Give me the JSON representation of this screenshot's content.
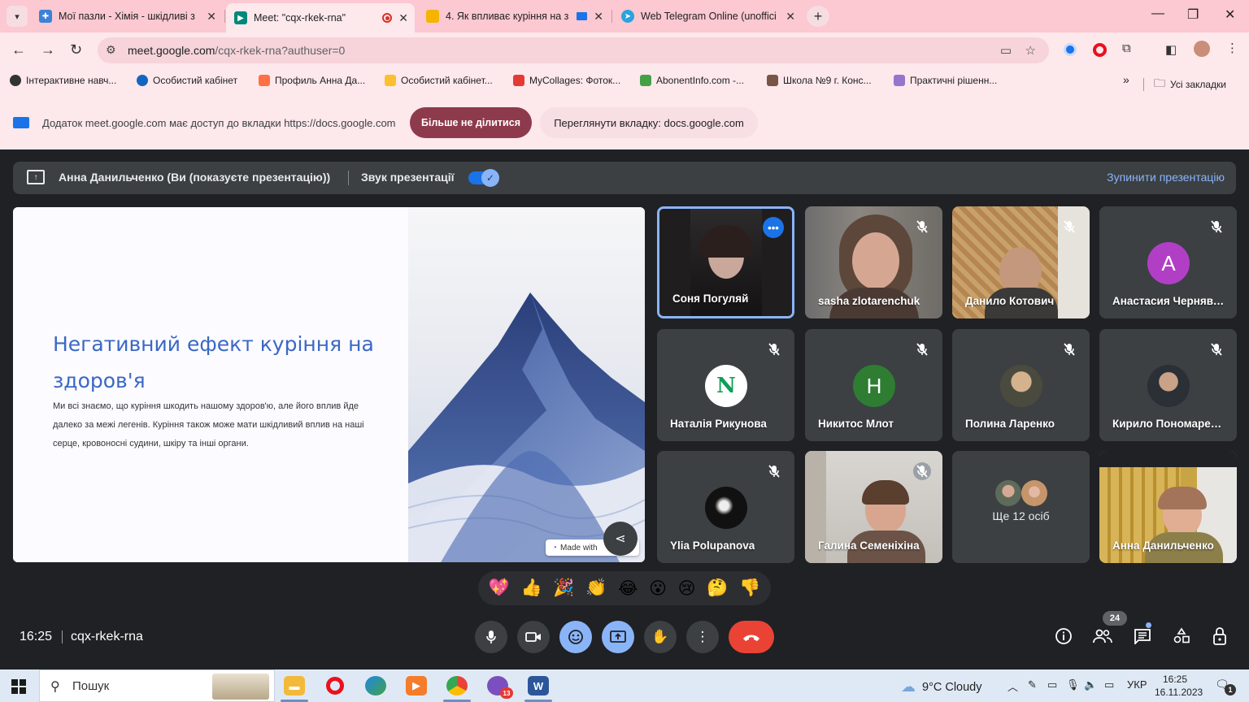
{
  "browser": {
    "tabs": [
      {
        "title": "Мої пазли - Хімія - шкідливі з",
        "favicon_color": "#3b82d8",
        "active": false,
        "recording": false
      },
      {
        "title": "Meet: \"cqx-rkek-rna\"",
        "favicon_color": "#00897b",
        "active": true,
        "recording": true
      },
      {
        "title": "4. Як впливає куріння на з",
        "favicon_color": "#f4b400",
        "active": false,
        "recording": false
      },
      {
        "title": "Web Telegram Online (unoffici",
        "favicon_color": "#2aa3df",
        "active": false,
        "recording": false
      }
    ],
    "url_host": "meet.google.com",
    "url_path": "/cqx-rkek-rna?authuser=0",
    "bookmarks": [
      {
        "label": "Інтерактивне навч...",
        "color": "#333333"
      },
      {
        "label": "Особистий кабінет",
        "color": "#1565c0"
      },
      {
        "label": "Профиль Анна Да...",
        "color": "#ff7043"
      },
      {
        "label": "Особистий кабінет...",
        "color": "#fbc02d"
      },
      {
        "label": "MyCollages: Фоток...",
        "color": "#e53935"
      },
      {
        "label": "AbonentInfo.com -...",
        "color": "#43a047"
      },
      {
        "label": "Школа №9 г. Конс...",
        "color": "#795548"
      },
      {
        "label": "Практичні рішенн...",
        "color": "#9575cd"
      }
    ],
    "bookmarks_overflow": "»",
    "all_bookmarks": "Усі закладки",
    "share_notice": "Додаток meet.google.com має доступ до вкладки https://docs.google.com",
    "stop_sharing_label": "Більше не ділитися",
    "view_tab_label": "Переглянути вкладку: docs.google.com"
  },
  "meet": {
    "presenter_text": "Анна Данильченко (Ви (показуєте презентацію))",
    "audio_label": "Звук презентації",
    "stop_presenting": "Зупинити презентацію",
    "slide": {
      "title": "Негативний ефект куріння на здоров'я",
      "body": "Ми всі знаємо, що куріння шкодить нашому здоров'ю, але його вплив йде далеко за межі легенів. Куріння також може мати шкідливий вплив на наші серце, кровоносні судини, шкіру та інші органи.",
      "made_with": "Made with"
    },
    "participants": [
      {
        "name": "Соня Погуляй",
        "kind": "video",
        "active": true
      },
      {
        "name": "sasha zlotarenchuk",
        "kind": "video"
      },
      {
        "name": "Данило Котович",
        "kind": "video"
      },
      {
        "name": "Анастасия Чернявська",
        "kind": "letter",
        "letter": "A",
        "color": "#b13fc6"
      },
      {
        "name": "Наталія Рикунова",
        "kind": "letter",
        "letter": "N",
        "color": "#ffffff"
      },
      {
        "name": "Никитос Млот",
        "kind": "letter",
        "letter": "H",
        "color": "#2e7d32"
      },
      {
        "name": "Полина Ларенко",
        "kind": "photo"
      },
      {
        "name": "Кирило Пономаренко",
        "kind": "photo"
      },
      {
        "name": "Ylia Polupanova",
        "kind": "photo"
      },
      {
        "name": "Галина Семеніхіна",
        "kind": "video"
      },
      {
        "name": "Ще 12 осіб",
        "kind": "more"
      },
      {
        "name": "Анна Данильченко",
        "kind": "video"
      }
    ],
    "reactions": [
      "💖",
      "👍",
      "🎉",
      "👏",
      "😂",
      "😮",
      "😢",
      "🤔",
      "👎"
    ],
    "time": "16:25",
    "meeting_code": "cqx-rkek-rna",
    "people_count": "24"
  },
  "taskbar": {
    "search_placeholder": "Пошук",
    "weather": "9°C  Cloudy",
    "language": "УКР",
    "time": "16:25",
    "date": "16.11.2023",
    "notifications": "1",
    "badge_viber": "13"
  },
  "colors": {
    "chrome_pink": "#fcc8d1",
    "meet_bg": "#202124",
    "tile_bg": "#3c4043",
    "accent_blue": "#8ab4f8",
    "end_red": "#ea4335"
  }
}
